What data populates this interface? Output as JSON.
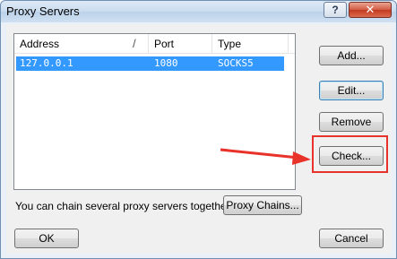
{
  "window": {
    "title": "Proxy Servers",
    "help_label": "?",
    "close_label": "✕"
  },
  "list": {
    "columns": [
      "Address",
      "Port",
      "Type"
    ],
    "rows": [
      {
        "address": "127.0.0.1",
        "port": "1080",
        "type": "SOCKS5"
      }
    ]
  },
  "buttons": {
    "add": "Add...",
    "edit": "Edit...",
    "remove": "Remove",
    "check": "Check...",
    "proxy_chains": "Proxy Chains...",
    "ok": "OK",
    "cancel": "Cancel"
  },
  "hint": "You can chain several proxy servers together:",
  "colors": {
    "selection": "#3399ff",
    "annotation": "#e8322a"
  },
  "icons": {
    "help": "help-icon",
    "close": "close-icon"
  }
}
